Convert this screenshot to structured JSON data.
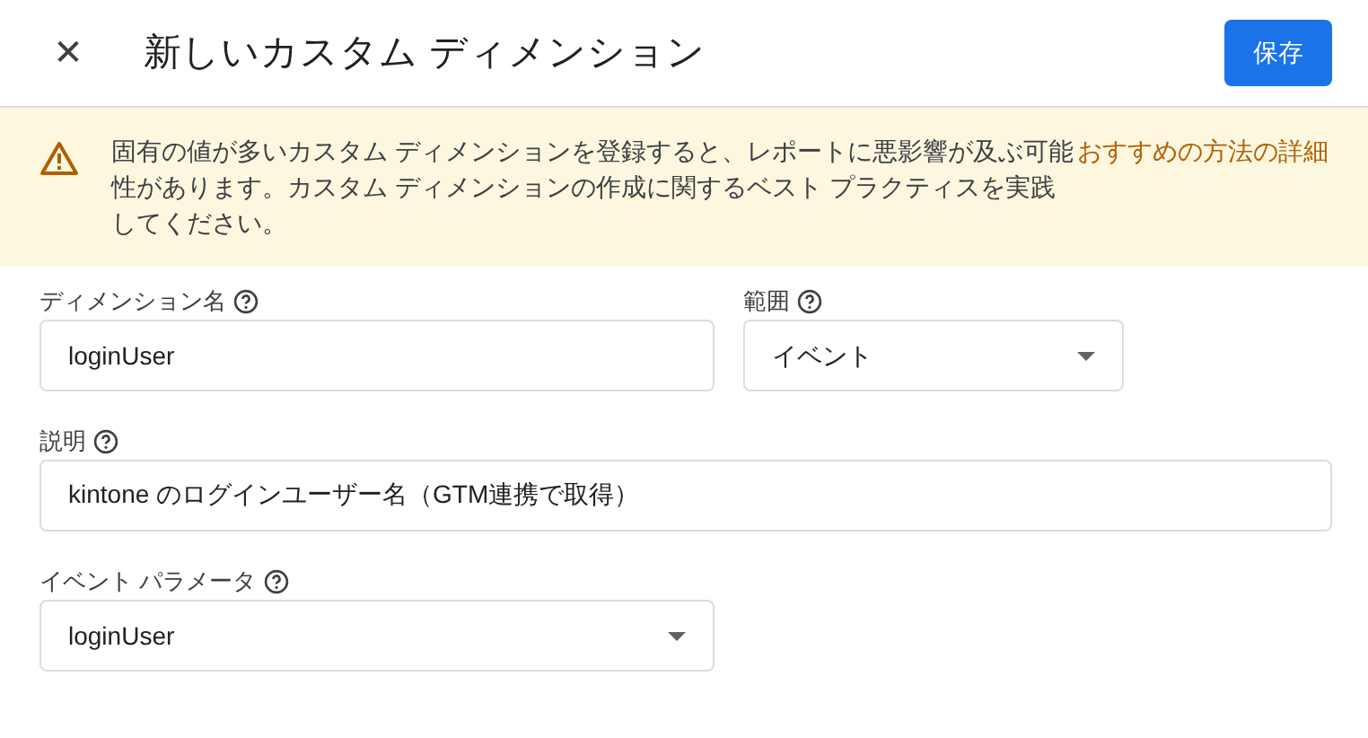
{
  "header": {
    "close": "✕",
    "title": "新しいカスタム ディメンション",
    "save_button": "保存"
  },
  "warning": {
    "message": "固有の値が多いカスタム ディメンションを登録すると、レポートに悪影響が及ぶ可能性があります。カスタム ディメンションの作成に関するベスト プラクティスを実践してください。",
    "link": "おすすめの方法の詳細"
  },
  "fields": [
    {
      "label": "ディメンション名",
      "kind": "text",
      "value": "loginUser"
    },
    {
      "label": "範囲",
      "kind": "select",
      "value": "イベント"
    },
    {
      "label": "説明",
      "kind": "text",
      "value": "kintone のログインユーザー名（GTM連携で取得）"
    },
    {
      "label": "イベント パラメータ",
      "kind": "select",
      "value": "loginUser"
    }
  ]
}
